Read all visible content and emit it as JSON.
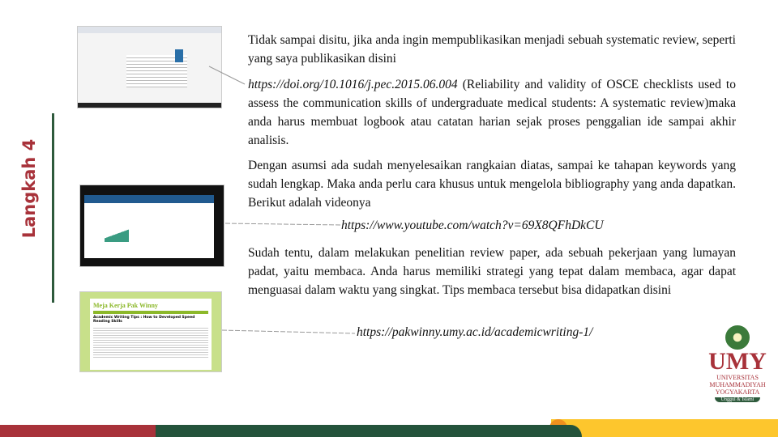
{
  "side_title": "Langkah 4",
  "paragraphs": {
    "p1": "Tidak sampai disitu, jika anda ingin mempublikasikan menjadi sebuah systematic review, seperti yang saya publikasikan disini",
    "p2_link": "https://doi.org/10.1016/j.pec.2015.06.004",
    "p2_text": " (Reliability and validity of OSCE checklists used to assess the communication skills of undergraduate medical students: A systematic review)maka anda harus membuat logbook atau catatan harian sejak proses penggalian ide sampai akhir analisis.",
    "p3": "Dengan asumsi ada sudah menyelesaikan rangkaian diatas, sampai ke tahapan keywords yang sudah lengkap. Maka anda perlu cara khusus untuk mengelola bibliography yang anda dapatkan. Berikut adalah videonya",
    "p3_link": "https://www.youtube.com/watch?v=69X8QFhDkCU",
    "p4": "Sudah tentu, dalam melakukan penelitian review paper, ada sebuah pekerjaan yang lumayan padat, yaitu membaca. Anda harus memiliki strategi yang tepat dalam membaca, agar dapat menguasai dalam waktu yang singkat. Tips membaca tersebut bisa didapatkan disini",
    "p4_link": "https://pakwinny.umy.ac.id/academicwriting-1/"
  },
  "thumbnails": {
    "t3_title": "Meja Kerja Pak Winny",
    "t3_heading": "Academic Writing Tips : How to Developed Speed Reading Skills"
  },
  "logo": {
    "name": "UMY",
    "sub1": "UNIVERSITAS",
    "sub2": "MUHAMMADIYAH",
    "sub3": "YOGYAKARTA",
    "tagline": "Unggul & Islami"
  },
  "colors": {
    "red": "#a8323a",
    "green": "#24533b",
    "yellow": "#fdc62d",
    "orange": "#f0901e"
  }
}
